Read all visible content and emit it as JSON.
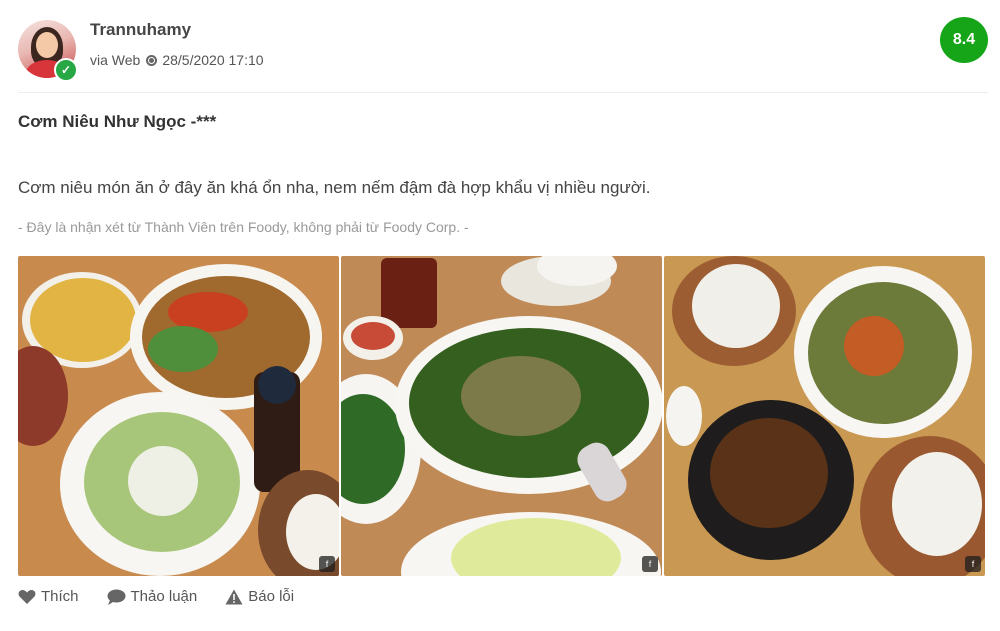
{
  "post": {
    "username": "Trannuhamy",
    "source": "via Web",
    "datetime": "28/5/2020 17:10",
    "score": "8.4",
    "title": "Cơm Niêu Như Ngọc -***",
    "body": "Cơm niêu món ăn ở đây ăn khá ổn nha, nem nếm đậm đà hợp khẩu vị nhiều người.",
    "disclaimer": "- Đây là nhận xét từ Thành Viên trên Foody, không phải từ Foody Corp. -"
  },
  "photos": [
    {
      "name": "photo-soup-and-salad"
    },
    {
      "name": "photo-vegetable-soup"
    },
    {
      "name": "photo-clay-pot-meal"
    }
  ],
  "actions": {
    "like_label": "Thích",
    "discuss_label": "Thảo luận",
    "report_label": "Báo lỗi"
  },
  "colors": {
    "score_badge": "#16a518",
    "verified_badge": "#28a745",
    "muted_text": "#999999"
  },
  "icons": [
    "verified-check-icon",
    "globe-icon",
    "heart-icon",
    "chat-icon",
    "warning-icon"
  ]
}
